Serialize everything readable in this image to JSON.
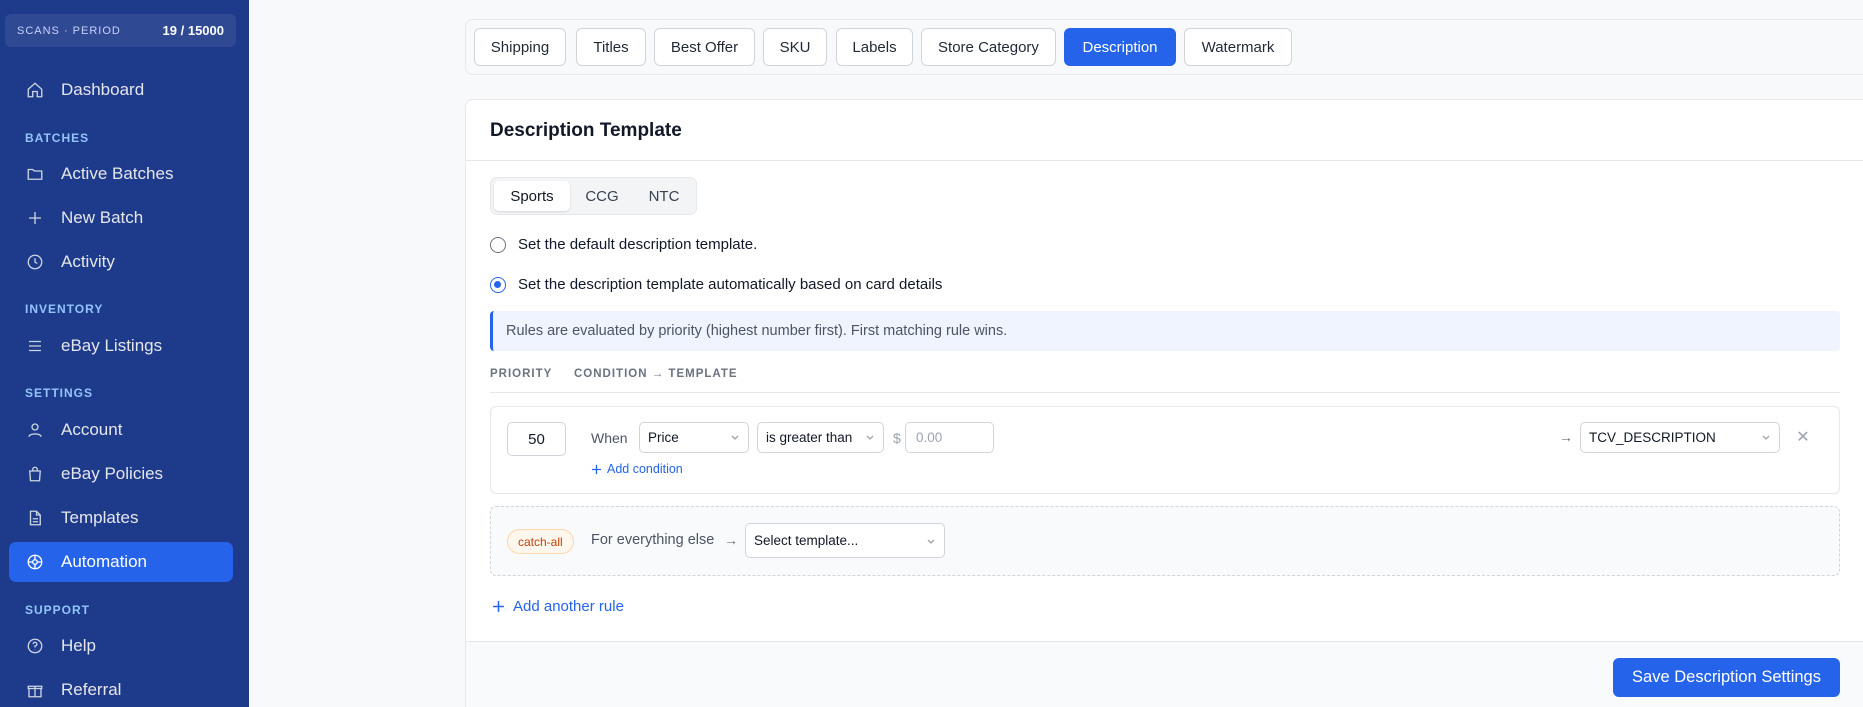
{
  "sidebar": {
    "scans_label": "SCANS · PERIOD",
    "scans_value": "19 / 15000",
    "items": {
      "dashboard": "Dashboard",
      "active_batches": "Active Batches",
      "new_batch": "New Batch",
      "activity": "Activity",
      "ebay_listings": "eBay Listings",
      "account": "Account",
      "ebay_policies": "eBay Policies",
      "templates": "Templates",
      "automation": "Automation",
      "help": "Help",
      "referral": "Referral"
    },
    "sections": {
      "batches": "BATCHES",
      "inventory": "INVENTORY",
      "settings": "SETTINGS",
      "support": "SUPPORT"
    },
    "active_color": "#2563eb",
    "bg_color": "#1e3a8a"
  },
  "tabs": {
    "shipping": "Shipping",
    "titles": "Titles",
    "best_offer": "Best Offer",
    "sku": "SKU",
    "labels": "Labels",
    "store_category": "Store Category",
    "description": "Description",
    "watermark": "Watermark",
    "active": "Description"
  },
  "card": {
    "title": "Description Template",
    "segments": {
      "sports": "Sports",
      "ccg": "CCG",
      "ntc": "NTC",
      "active": "Sports"
    },
    "radio_default": "Set the default description template.",
    "radio_auto": "Set the description template automatically based on card details",
    "radio_selected": "auto",
    "info": "Rules are evaluated by priority (highest number first). First matching rule wins.",
    "col_priority": "PRIORITY",
    "col_condition": "CONDITION → TEMPLATE",
    "rule": {
      "priority": "50",
      "when": "When",
      "field": "Price",
      "operator": "is greater than",
      "currency": "$",
      "value_placeholder": "0.00",
      "template": "TCV_DESCRIPTION",
      "add_condition": "Add condition"
    },
    "catch_all": {
      "badge": "catch-all",
      "text": "For everything else",
      "template_placeholder": "Select template..."
    },
    "add_rule": "Add another rule",
    "save": "Save Description Settings"
  }
}
